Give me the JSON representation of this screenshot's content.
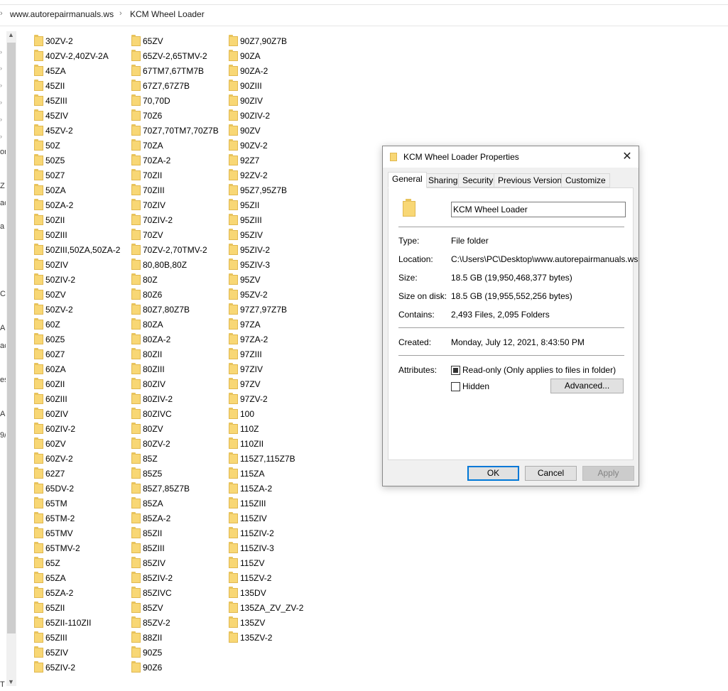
{
  "breadcrumb": [
    "www.autorepairmanuals.ws",
    "KCM Wheel Loader"
  ],
  "nav_fragments": [
    "or",
    "Z",
    "ac",
    "a",
    "C",
    "A",
    "ac",
    "es",
    "Al",
    "9/",
    "T"
  ],
  "columns": [
    [
      "30ZV-2",
      "40ZV-2,40ZV-2A",
      "45ZA",
      "45ZII",
      "45ZIII",
      "45ZIV",
      "45ZV-2",
      "50Z",
      "50Z5",
      "50Z7",
      "50ZA",
      "50ZA-2",
      "50ZII",
      "50ZIII",
      "50ZIII,50ZA,50ZA-2",
      "50ZIV",
      "50ZIV-2",
      "50ZV",
      "50ZV-2",
      "60Z",
      "60Z5",
      "60Z7",
      "60ZA",
      "60ZII",
      "60ZIII",
      "60ZIV",
      "60ZIV-2",
      "60ZV",
      "60ZV-2",
      "62Z7",
      "65DV-2",
      "65TM",
      "65TM-2",
      "65TMV",
      "65TMV-2",
      "65Z",
      "65ZA",
      "65ZA-2",
      "65ZII",
      "65ZII-110ZII",
      "65ZIII",
      "65ZIV",
      "65ZIV-2"
    ],
    [
      "65ZV",
      "65ZV-2,65TMV-2",
      "67TM7,67TM7B",
      "67Z7,67Z7B",
      "70,70D",
      "70Z6",
      "70Z7,70TM7,70Z7B",
      "70ZA",
      "70ZA-2",
      "70ZII",
      "70ZIII",
      "70ZIV",
      "70ZIV-2",
      "70ZV",
      "70ZV-2,70TMV-2",
      "80,80B,80Z",
      "80Z",
      "80Z6",
      "80Z7,80Z7B",
      "80ZA",
      "80ZA-2",
      "80ZII",
      "80ZIII",
      "80ZIV",
      "80ZIV-2",
      "80ZIVC",
      "80ZV",
      "80ZV-2",
      "85Z",
      "85Z5",
      "85Z7,85Z7B",
      "85ZA",
      "85ZA-2",
      "85ZII",
      "85ZIII",
      "85ZIV",
      "85ZIV-2",
      "85ZIVC",
      "85ZV",
      "85ZV-2",
      "88ZII",
      "90Z5",
      "90Z6"
    ],
    [
      "90Z7,90Z7B",
      "90ZA",
      "90ZA-2",
      "90ZIII",
      "90ZIV",
      "90ZIV-2",
      "90ZV",
      "90ZV-2",
      "92Z7",
      "92ZV-2",
      "95Z7,95Z7B",
      "95ZII",
      "95ZIII",
      "95ZIV",
      "95ZIV-2",
      "95ZIV-3",
      "95ZV",
      "95ZV-2",
      "97Z7,97Z7B",
      "97ZA",
      "97ZA-2",
      "97ZIII",
      "97ZIV",
      "97ZV",
      "97ZV-2",
      "100",
      "110Z",
      "110ZII",
      "115Z7,115Z7B",
      "115ZA",
      "115ZA-2",
      "115ZIII",
      "115ZIV",
      "115ZIV-2",
      "115ZIV-3",
      "115ZV",
      "115ZV-2",
      "135DV",
      "135ZA_ZV_ZV-2",
      "135ZV",
      "135ZV-2"
    ]
  ],
  "dialog": {
    "title": "KCM Wheel Loader Properties",
    "close_icon": "close-icon",
    "tabs": [
      "General",
      "Sharing",
      "Security",
      "Previous Versions",
      "Customize"
    ],
    "active_tab": "General",
    "name_value": "KCM Wheel Loader",
    "type_label": "Type:",
    "type_value": "File folder",
    "location_label": "Location:",
    "location_value": "C:\\Users\\PC\\Desktop\\www.autorepairmanuals.ws",
    "size_label": "Size:",
    "size_value": "18.5 GB (19,950,468,377 bytes)",
    "size_on_disk_label": "Size on disk:",
    "size_on_disk_value": "18.5 GB (19,955,552,256 bytes)",
    "contains_label": "Contains:",
    "contains_value": "2,493 Files, 2,095 Folders",
    "created_label": "Created:",
    "created_value": "Monday, July 12, 2021, 8:43:50 PM",
    "attributes_label": "Attributes:",
    "readonly_label": "Read-only (Only applies to files in folder)",
    "readonly_state": "indeterminate",
    "hidden_label": "Hidden",
    "hidden_state": "unchecked",
    "advanced_label": "Advanced...",
    "ok_label": "OK",
    "cancel_label": "Cancel",
    "apply_label": "Apply"
  },
  "colors": {
    "folder": "#f8d775",
    "accent": "#0078d7",
    "dialog_bg": "#f0f0f0"
  }
}
